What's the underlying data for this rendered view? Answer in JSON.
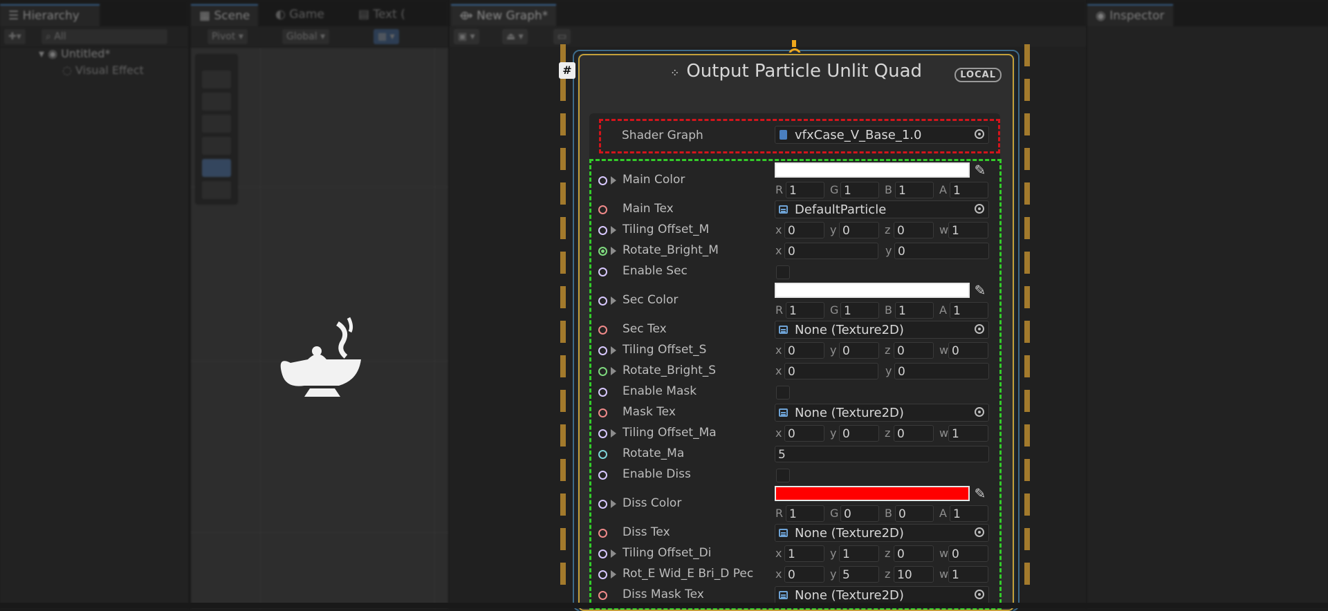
{
  "tabs": {
    "hierarchy": "Hierarchy",
    "scene": "Scene",
    "game": "Game",
    "text": "Text (",
    "graph": "New Graph*",
    "inspector": "Inspector"
  },
  "hierarchy": {
    "search_placeholder": "All",
    "scene_name": "Untitled*",
    "child": "Visual Effect"
  },
  "scene_toolbar": {
    "pivot": "Pivot",
    "global": "Global"
  },
  "node": {
    "title": "Output Particle Unlit Quad",
    "space_badge": "LOCAL",
    "shader_graph_label": "Shader Graph",
    "shader_graph_value": "vfxCase_V_Base_1.0"
  },
  "properties": [
    {
      "label": "Main Color"
    },
    {
      "label": "Main Tex",
      "value": "DefaultParticle"
    },
    {
      "label": "Tiling Offset_M",
      "x": "0",
      "y": "0",
      "z": "0",
      "w": "1"
    },
    {
      "label": "Rotate_Bright_M",
      "x": "0",
      "y": "0"
    },
    {
      "label": "Enable Sec"
    },
    {
      "label": "Sec Color"
    },
    {
      "label": "Sec Tex",
      "value": "None (Texture2D)"
    },
    {
      "label": "Tiling Offset_S",
      "x": "0",
      "y": "0",
      "z": "0",
      "w": "0"
    },
    {
      "label": "Rotate_Bright_S",
      "x": "0",
      "y": "0"
    },
    {
      "label": "Enable Mask"
    },
    {
      "label": "Mask Tex",
      "value": "None (Texture2D)"
    },
    {
      "label": "Tiling Offset_Ma",
      "x": "0",
      "y": "0",
      "z": "0",
      "w": "1"
    },
    {
      "label": "Rotate_Ma",
      "value": "5"
    },
    {
      "label": "Enable Diss"
    },
    {
      "label": "Diss Color"
    },
    {
      "label": "Diss Tex",
      "value": "None (Texture2D)"
    },
    {
      "label": "Tiling Offset_Di",
      "x": "1",
      "y": "1",
      "z": "0",
      "w": "0"
    },
    {
      "label": "Rot_E Wid_E Bri_D Pec",
      "x": "0",
      "y": "5",
      "z": "10",
      "w": "1"
    },
    {
      "label": "Diss Mask Tex",
      "value": "None (Texture2D)"
    }
  ],
  "colors": {
    "main": {
      "r": "1",
      "g": "1",
      "b": "1",
      "a": "1",
      "swatch": "#ffffff"
    },
    "sec": {
      "r": "1",
      "g": "1",
      "b": "1",
      "a": "1",
      "swatch": "#ffffff"
    },
    "diss": {
      "r": "1",
      "g": "0",
      "b": "0",
      "a": "1",
      "swatch": "#ff0000"
    }
  },
  "component_labels": {
    "r": "R",
    "g": "G",
    "b": "B",
    "a": "A",
    "x": "x",
    "y": "y",
    "z": "z",
    "w": "w"
  },
  "accent_colors": {
    "node_border": "#c6a13a",
    "red_highlight": "#d4141b",
    "green_highlight": "#33cc2a"
  }
}
